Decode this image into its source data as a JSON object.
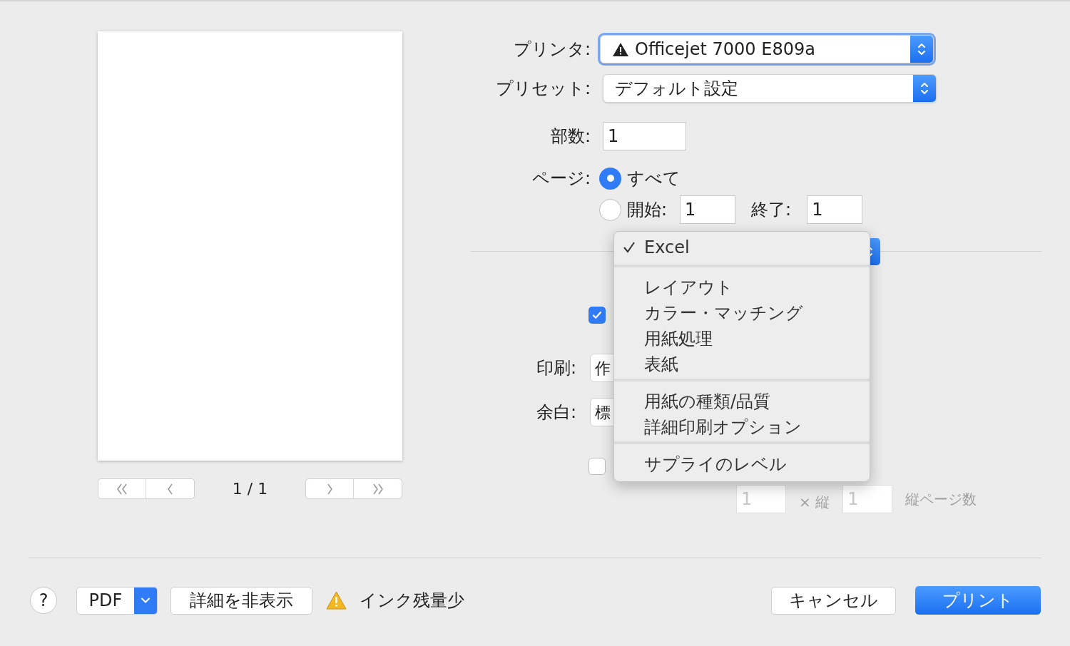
{
  "preview": {
    "page_indicator": "1 / 1"
  },
  "printer": {
    "label": "プリンタ:",
    "value": "Officejet 7000 E809a",
    "focused": true
  },
  "preset": {
    "label": "プリセット:",
    "value": "デフォルト設定"
  },
  "copies": {
    "label": "部数:",
    "value": "1"
  },
  "pages": {
    "label": "ページ:",
    "options": [
      {
        "label": "すべて",
        "selected": true
      },
      {
        "label": "開始:",
        "selected": false
      }
    ],
    "from": "1",
    "to_label": "終了:",
    "to": "1"
  },
  "options": {
    "first_checkbox": {
      "checked": true
    },
    "print": {
      "label": "印刷:",
      "value": "作"
    },
    "margins": {
      "label": "余白:",
      "value": "標"
    },
    "second_checkbox": {
      "checked": false
    },
    "tiling": {
      "across": "1",
      "times": "× 縦",
      "down": "1",
      "down_label": "縦ページ数"
    }
  },
  "menu": {
    "groups": [
      {
        "items": [
          {
            "label": "Excel",
            "checked": true
          }
        ]
      },
      {
        "items": [
          {
            "label": "レイアウト",
            "checked": false
          },
          {
            "label": "カラー・マッチング",
            "checked": false
          },
          {
            "label": "用紙処理",
            "checked": false
          },
          {
            "label": "表紙",
            "checked": false
          }
        ]
      },
      {
        "items": [
          {
            "label": "用紙の種類/品質",
            "checked": false
          },
          {
            "label": "詳細印刷オプション",
            "checked": false
          }
        ]
      },
      {
        "items": [
          {
            "label": "サプライのレベル",
            "checked": false
          }
        ]
      }
    ]
  },
  "footer": {
    "help": "?",
    "pdf": "PDF",
    "details_button": "詳細を非表示",
    "status": "インク残量少",
    "cancel": "キャンセル",
    "print": "プリント"
  }
}
